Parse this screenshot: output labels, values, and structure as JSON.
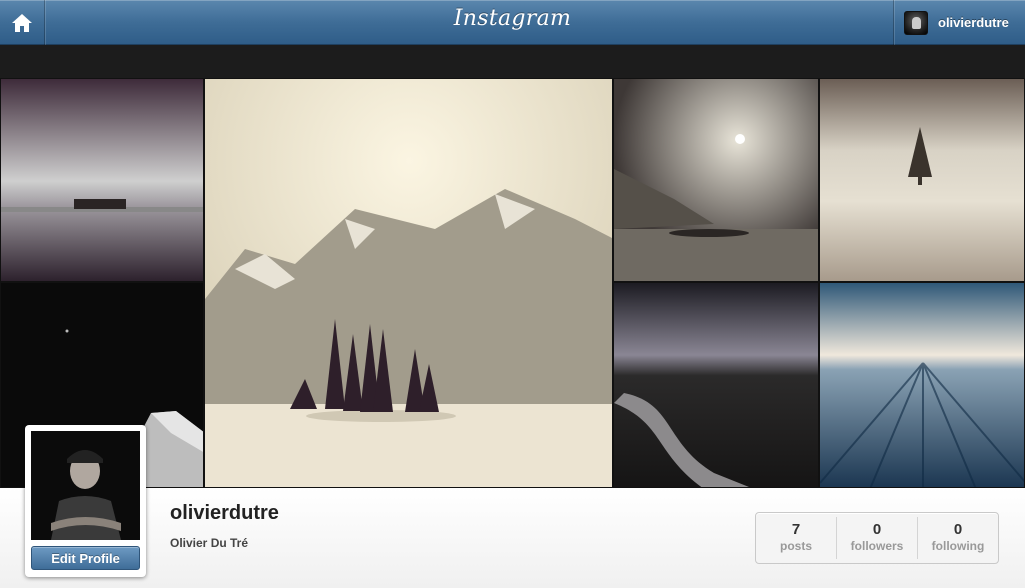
{
  "header": {
    "logo": "Instagram",
    "username": "olivierdutre"
  },
  "icons": {
    "home": "home-icon",
    "avatar": "user-avatar"
  },
  "colors": {
    "header_blue": "#3f6d97",
    "button_blue": "#4f7fab"
  },
  "profile": {
    "username": "olivierdutre",
    "full_name": "Olivier Du Tré",
    "edit_label": "Edit Profile"
  },
  "stats": [
    {
      "count": "7",
      "label": "posts"
    },
    {
      "count": "0",
      "label": "followers"
    },
    {
      "count": "0",
      "label": "following"
    }
  ]
}
